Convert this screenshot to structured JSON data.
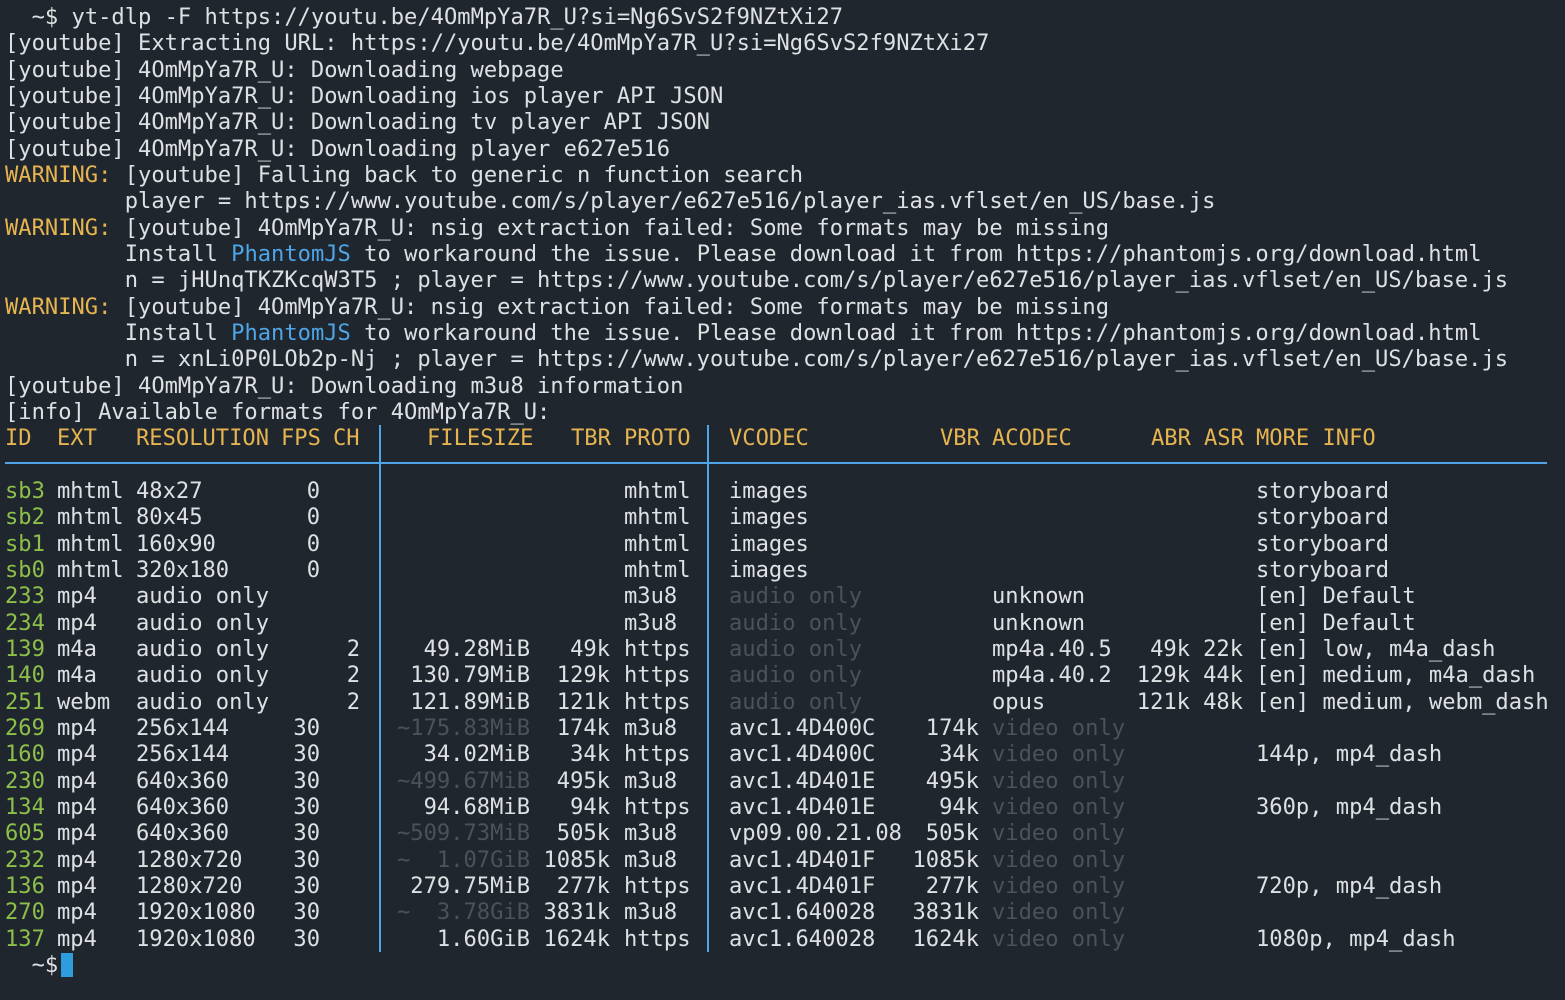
{
  "prompt": "  ~$",
  "command": " yt-dlp -F https://youtu.be/4OmMpYa7R_U?si=Ng6SvS2f9NZtXi27",
  "log": {
    "l1": "[youtube] Extracting URL: https://youtu.be/4OmMpYa7R_U?si=Ng6SvS2f9NZtXi27",
    "l2": "[youtube] 4OmMpYa7R_U: Downloading webpage",
    "l3": "[youtube] 4OmMpYa7R_U: Downloading ios player API JSON",
    "l4": "[youtube] 4OmMpYa7R_U: Downloading tv player API JSON",
    "l5": "[youtube] 4OmMpYa7R_U: Downloading player e627e516",
    "warn_label": "WARNING:",
    "w1": " [youtube] Falling back to generic n function search",
    "w1b": "         player = https://www.youtube.com/s/player/e627e516/player_ias.vflset/en_US/base.js",
    "w2": " [youtube] 4OmMpYa7R_U: nsig extraction failed: Some formats may be missing",
    "install_pre": "         Install ",
    "phantom": "PhantomJS",
    "install_post": " to workaround the issue. Please download it from https://phantomjs.org/download.html",
    "w2b": "         n = jHUnqTKZKcqW3T5 ; player = https://www.youtube.com/s/player/e627e516/player_ias.vflset/en_US/base.js",
    "w3": " [youtube] 4OmMpYa7R_U: nsig extraction failed: Some formats may be missing",
    "w3b": "         n = xnLi0P0LOb2p-Nj ; player = https://www.youtube.com/s/player/e627e516/player_ias.vflset/en_US/base.js",
    "l6": "[youtube] 4OmMpYa7R_U: Downloading m3u8 information",
    "l7": "[info] Available formats for 4OmMpYa7R_U:"
  },
  "headers": {
    "id": "ID",
    "ext": "EXT",
    "res": "RESOLUTION",
    "fps": "FPS",
    "ch": "CH",
    "size": "FILESIZE",
    "tbr": "TBR",
    "proto": "PROTO",
    "vcodec": "VCODEC",
    "vbr": "VBR",
    "acodec": "ACODEC",
    "abr": "ABR",
    "asr": "ASR",
    "info": "MORE INFO"
  },
  "formats": [
    {
      "id": "sb3",
      "ext": "mhtml",
      "res": "48x27",
      "fps": "0",
      "ch": "",
      "size": "",
      "size_dim": false,
      "tbr": "",
      "proto": "mhtml",
      "vcodec": "images",
      "vcodec_dim": false,
      "vbr": "",
      "acodec": "",
      "acodec_dim": false,
      "abr": "",
      "asr": "",
      "info": "storyboard"
    },
    {
      "id": "sb2",
      "ext": "mhtml",
      "res": "80x45",
      "fps": "0",
      "ch": "",
      "size": "",
      "size_dim": false,
      "tbr": "",
      "proto": "mhtml",
      "vcodec": "images",
      "vcodec_dim": false,
      "vbr": "",
      "acodec": "",
      "acodec_dim": false,
      "abr": "",
      "asr": "",
      "info": "storyboard"
    },
    {
      "id": "sb1",
      "ext": "mhtml",
      "res": "160x90",
      "fps": "0",
      "ch": "",
      "size": "",
      "size_dim": false,
      "tbr": "",
      "proto": "mhtml",
      "vcodec": "images",
      "vcodec_dim": false,
      "vbr": "",
      "acodec": "",
      "acodec_dim": false,
      "abr": "",
      "asr": "",
      "info": "storyboard"
    },
    {
      "id": "sb0",
      "ext": "mhtml",
      "res": "320x180",
      "fps": "0",
      "ch": "",
      "size": "",
      "size_dim": false,
      "tbr": "",
      "proto": "mhtml",
      "vcodec": "images",
      "vcodec_dim": false,
      "vbr": "",
      "acodec": "",
      "acodec_dim": false,
      "abr": "",
      "asr": "",
      "info": "storyboard"
    },
    {
      "id": "233",
      "ext": "mp4",
      "res": "audio only",
      "fps": "",
      "ch": "",
      "size": "",
      "size_dim": false,
      "tbr": "",
      "proto": "m3u8",
      "vcodec": "audio only",
      "vcodec_dim": true,
      "vbr": "",
      "acodec": "unknown",
      "acodec_dim": false,
      "abr": "",
      "asr": "",
      "info": "[en] Default"
    },
    {
      "id": "234",
      "ext": "mp4",
      "res": "audio only",
      "fps": "",
      "ch": "",
      "size": "",
      "size_dim": false,
      "tbr": "",
      "proto": "m3u8",
      "vcodec": "audio only",
      "vcodec_dim": true,
      "vbr": "",
      "acodec": "unknown",
      "acodec_dim": false,
      "abr": "",
      "asr": "",
      "info": "[en] Default"
    },
    {
      "id": "139",
      "ext": "m4a",
      "res": "audio only",
      "fps": "",
      "ch": "2",
      "size": "49.28MiB",
      "size_dim": false,
      "tbr": "49k",
      "proto": "https",
      "vcodec": "audio only",
      "vcodec_dim": true,
      "vbr": "",
      "acodec": "mp4a.40.5",
      "acodec_dim": false,
      "abr": "49k",
      "asr": "22k",
      "info": "[en] low, m4a_dash"
    },
    {
      "id": "140",
      "ext": "m4a",
      "res": "audio only",
      "fps": "",
      "ch": "2",
      "size": "130.79MiB",
      "size_dim": false,
      "tbr": "129k",
      "proto": "https",
      "vcodec": "audio only",
      "vcodec_dim": true,
      "vbr": "",
      "acodec": "mp4a.40.2",
      "acodec_dim": false,
      "abr": "129k",
      "asr": "44k",
      "info": "[en] medium, m4a_dash"
    },
    {
      "id": "251",
      "ext": "webm",
      "res": "audio only",
      "fps": "",
      "ch": "2",
      "size": "121.89MiB",
      "size_dim": false,
      "tbr": "121k",
      "proto": "https",
      "vcodec": "audio only",
      "vcodec_dim": true,
      "vbr": "",
      "acodec": "opus",
      "acodec_dim": false,
      "abr": "121k",
      "asr": "48k",
      "info": "[en] medium, webm_dash"
    },
    {
      "id": "269",
      "ext": "mp4",
      "res": "256x144",
      "fps": "30",
      "ch": "",
      "size": "~175.83MiB",
      "size_dim": true,
      "tbr": "174k",
      "proto": "m3u8",
      "vcodec": "avc1.4D400C",
      "vcodec_dim": false,
      "vbr": "174k",
      "acodec": "video only",
      "acodec_dim": true,
      "abr": "",
      "asr": "",
      "info": ""
    },
    {
      "id": "160",
      "ext": "mp4",
      "res": "256x144",
      "fps": "30",
      "ch": "",
      "size": "34.02MiB",
      "size_dim": false,
      "tbr": "34k",
      "proto": "https",
      "vcodec": "avc1.4D400C",
      "vcodec_dim": false,
      "vbr": "34k",
      "acodec": "video only",
      "acodec_dim": true,
      "abr": "",
      "asr": "",
      "info": "144p, mp4_dash"
    },
    {
      "id": "230",
      "ext": "mp4",
      "res": "640x360",
      "fps": "30",
      "ch": "",
      "size": "~499.67MiB",
      "size_dim": true,
      "tbr": "495k",
      "proto": "m3u8",
      "vcodec": "avc1.4D401E",
      "vcodec_dim": false,
      "vbr": "495k",
      "acodec": "video only",
      "acodec_dim": true,
      "abr": "",
      "asr": "",
      "info": ""
    },
    {
      "id": "134",
      "ext": "mp4",
      "res": "640x360",
      "fps": "30",
      "ch": "",
      "size": "94.68MiB",
      "size_dim": false,
      "tbr": "94k",
      "proto": "https",
      "vcodec": "avc1.4D401E",
      "vcodec_dim": false,
      "vbr": "94k",
      "acodec": "video only",
      "acodec_dim": true,
      "abr": "",
      "asr": "",
      "info": "360p, mp4_dash"
    },
    {
      "id": "605",
      "ext": "mp4",
      "res": "640x360",
      "fps": "30",
      "ch": "",
      "size": "~509.73MiB",
      "size_dim": true,
      "tbr": "505k",
      "proto": "m3u8",
      "vcodec": "vp09.00.21.08",
      "vcodec_dim": false,
      "vbr": "505k",
      "acodec": "video only",
      "acodec_dim": true,
      "abr": "",
      "asr": "",
      "info": ""
    },
    {
      "id": "232",
      "ext": "mp4",
      "res": "1280x720",
      "fps": "30",
      "ch": "",
      "size": "~  1.07GiB",
      "size_dim": true,
      "tbr": "1085k",
      "proto": "m3u8",
      "vcodec": "avc1.4D401F",
      "vcodec_dim": false,
      "vbr": "1085k",
      "acodec": "video only",
      "acodec_dim": true,
      "abr": "",
      "asr": "",
      "info": ""
    },
    {
      "id": "136",
      "ext": "mp4",
      "res": "1280x720",
      "fps": "30",
      "ch": "",
      "size": "279.75MiB",
      "size_dim": false,
      "tbr": "277k",
      "proto": "https",
      "vcodec": "avc1.4D401F",
      "vcodec_dim": false,
      "vbr": "277k",
      "acodec": "video only",
      "acodec_dim": true,
      "abr": "",
      "asr": "",
      "info": "720p, mp4_dash"
    },
    {
      "id": "270",
      "ext": "mp4",
      "res": "1920x1080",
      "fps": "30",
      "ch": "",
      "size": "~  3.78GiB",
      "size_dim": true,
      "tbr": "3831k",
      "proto": "m3u8",
      "vcodec": "avc1.640028",
      "vcodec_dim": false,
      "vbr": "3831k",
      "acodec": "video only",
      "acodec_dim": true,
      "abr": "",
      "asr": "",
      "info": ""
    },
    {
      "id": "137",
      "ext": "mp4",
      "res": "1920x1080",
      "fps": "30",
      "ch": "",
      "size": "1.60GiB",
      "size_dim": false,
      "tbr": "1624k",
      "proto": "https",
      "vcodec": "avc1.640028",
      "vcodec_dim": false,
      "vbr": "1624k",
      "acodec": "video only",
      "acodec_dim": true,
      "abr": "",
      "asr": "",
      "info": "1080p, mp4_dash"
    }
  ],
  "colors": {
    "background": "#20262d",
    "text": "#dde1e4",
    "warning": "#e6b450",
    "link": "#4ea6e8",
    "format_id": "#8cc04a",
    "dim": "#4b5259",
    "cursor": "#2e9de0"
  }
}
